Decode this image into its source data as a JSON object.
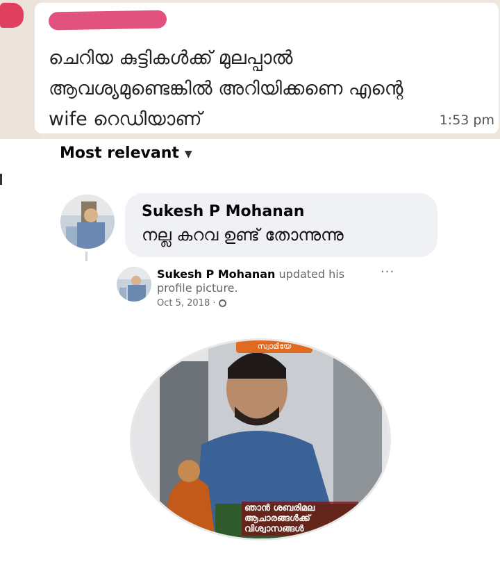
{
  "whatsapp": {
    "message_text": "ചെറിയ കുട്ടികൾക്ക് മുലപ്പാൽ ആവശ്യമുണ്ടെങ്കിൽ അറിയിക്കണെ എന്റെ wife റെഡിയാണ്",
    "time": "1:53 pm"
  },
  "facebook": {
    "sort_label": "Most relevant",
    "comment": {
      "author": "Sukesh P Mohanan",
      "text": "നല്ല കറവ ഉണ്ട് തോന്നുന്നു"
    },
    "post": {
      "author": "Sukesh P Mohanan",
      "action": " updated his profile picture.",
      "date": "Oct 5, 2018 ·",
      "more_label": "···",
      "frame_banner": "സ്വാമിയേ",
      "frame_text": "ഞാൻ ശബരിമല ആചാരങ്ങൾക്ക് വിശ്വാസങ്ങൾ"
    }
  },
  "icons": [
    "chevron-down-icon",
    "globe-icon",
    "more-icon"
  ],
  "colors": {
    "chat_bg": "#efe7de",
    "redaction": "#e2527e",
    "comment_bubble": "#eff1f4"
  }
}
